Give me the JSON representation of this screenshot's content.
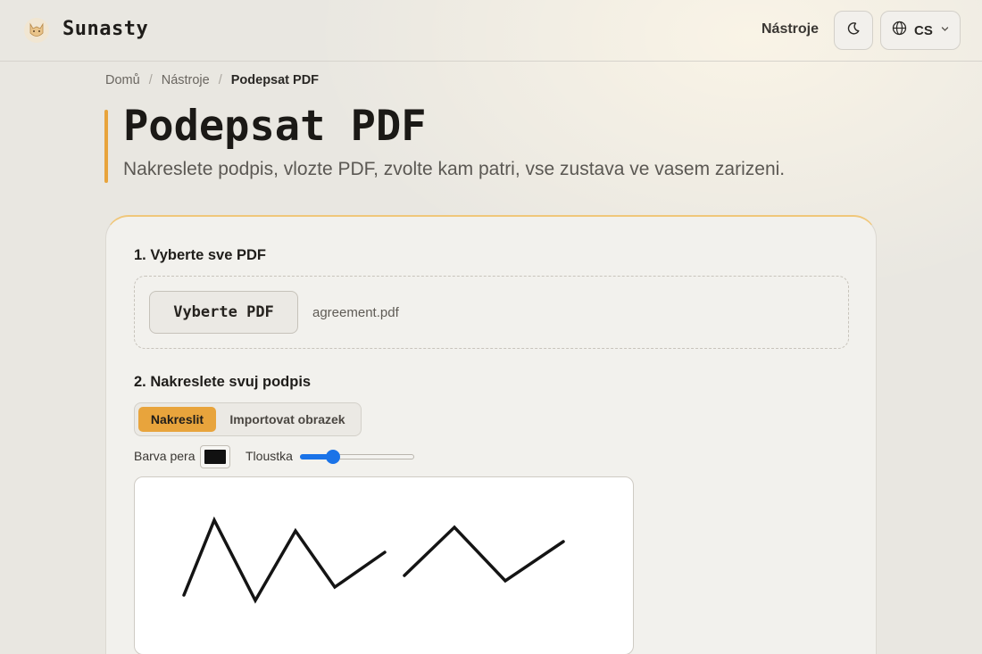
{
  "brand": {
    "name": "Sunasty",
    "logo_icon": "fox-cat-logo-icon"
  },
  "header": {
    "nav_link": "Nástroje",
    "theme_icon": "moon-icon",
    "language": {
      "code": "CS",
      "icon": "globe-icon",
      "chevron": "chevron-down-icon"
    }
  },
  "breadcrumb": {
    "items": [
      "Domů",
      "Nástroje"
    ],
    "current": "Podepsat PDF",
    "separator": "/"
  },
  "page": {
    "title": "Podepsat PDF",
    "subtitle": "Nakreslete podpis, vlozte PDF, zvolte kam patri, vse zustava ve vasem zarizeni."
  },
  "step1": {
    "label": "1. Vyberte sve PDF",
    "button": "Vyberte PDF",
    "file_name": "agreement.pdf"
  },
  "step2": {
    "label": "2. Nakreslete svuj podpis",
    "modes": [
      "Nakreslit",
      "Importovat obrazek"
    ],
    "active_mode": "Nakreslit",
    "pen_color_label": "Barva pera",
    "pen_color": "#111111",
    "thickness_label": "Tloustka",
    "thickness_fraction": 0.26
  },
  "colors": {
    "accent": "#e8a43c",
    "slider": "#1a73e8"
  }
}
